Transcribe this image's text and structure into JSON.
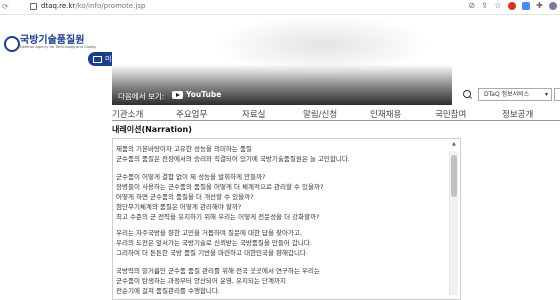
{
  "browser": {
    "nav_glyph": "⟳",
    "url_host": "dtaq.re.kr",
    "url_path": "/ko/info/promote.jsp",
    "right_icons": [
      "eye-off-icon",
      "share-icon",
      "star-icon",
      "puzzle-icon"
    ]
  },
  "header": {
    "logo_korean": "국방기술품질원",
    "logo_english": "Defense Agency for Technology and Quality",
    "media_button": "미디어룸"
  },
  "video": {
    "watch_on": "다음에서 보기:",
    "youtube": "YouTube"
  },
  "toolbar": {
    "service_select": "DTaQ 정보서비스",
    "caret": "▾"
  },
  "gnb": {
    "items": [
      "기관소개",
      "주요업무",
      "자료실",
      "알림/신청",
      "인재채용",
      "국민참여",
      "정보공개"
    ]
  },
  "content": {
    "section_title": "내레이션(Narration)",
    "lines": [
      "제품의 기본바탕이자 고유한 성능을 의미하는 품질",
      "군수품의 품질은 전장에서의 승리와 직결되어 있기에 국방기술품질원은 늘 고민합니다.",
      "",
      "군수품이 어떻게 결함 없이 제 성능을 발휘하게 만들까?",
      "장병들이 사용하는 군수품의 품질을 어떻게 더 체계적으로 관리할 수 있을까?",
      "어떻게 하면 군수품의 품질을 더 개선할 수 있을까?",
      "첨단무기체계의 품질은 어떻게 관리해야 할까?",
      "최고 수준의 군 전력을 유지하기 위해 우리는 어떻게 전문성을 더 강화할까?",
      "",
      "우리는 자주국방을 향한 고민을 거듭하며 질문에 대한 답을 찾아가고,",
      "우리의 도전은 앞서가는 국방기술로 신뢰받는 국방품질을 만들어 갑니다.",
      "그리하여 더 튼튼한 국방 품질 기반을 마련하고 대한민국을 향해갑니다.",
      "",
      "국방력의 밑거름인 군수품 품질 관리를 위해 전국 곳곳에서 연구하는 우리는",
      "군수품이 탄생하는 과정부터 양산되어 운영, 유지되는 단계까지",
      "전순기에 걸쳐 품질관리를 수행합니다."
    ]
  }
}
